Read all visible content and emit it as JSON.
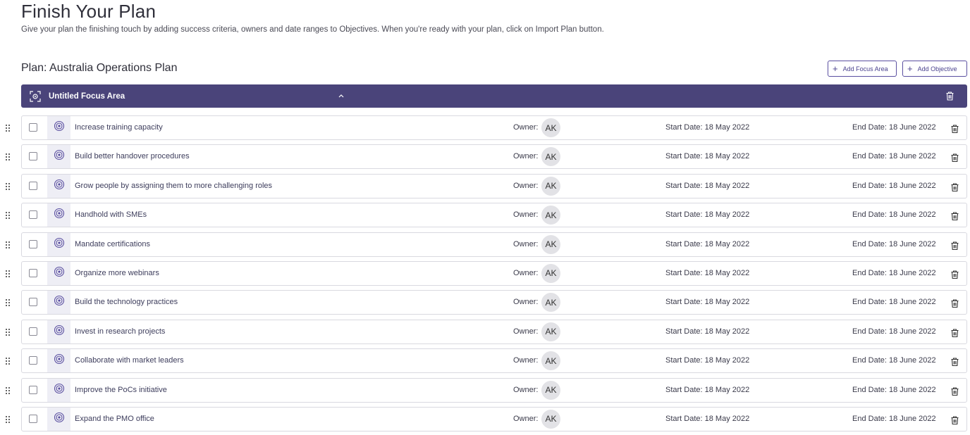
{
  "header": {
    "title": "Finish Your Plan",
    "subtitle": "Give your plan the finishing touch by adding success criteria, owners and date ranges to Objectives. When you're ready with your plan, click on Import Plan button."
  },
  "plan": {
    "title": "Plan: Australia Operations Plan",
    "add_focus_area_label": "Add Focus Area",
    "add_objective_label": "Add Objective"
  },
  "focus_area": {
    "title": "Untitled Focus Area"
  },
  "labels": {
    "owner": "Owner:"
  },
  "colors": {
    "focus_bar": "#4a447a",
    "accent": "#5a4fa0",
    "icon_bg": "#eeeef5"
  },
  "objectives": [
    {
      "title": "Increase training capacity",
      "owner": "AK",
      "start": "Start Date: 18 May 2022",
      "end": "End Date: 18 June 2022"
    },
    {
      "title": "Build better handover procedures",
      "owner": "AK",
      "start": "Start Date: 18 May 2022",
      "end": "End Date: 18 June 2022"
    },
    {
      "title": "Grow people by assigning them to more challenging roles",
      "owner": "AK",
      "start": "Start Date: 18 May 2022",
      "end": "End Date: 18 June 2022"
    },
    {
      "title": "Handhold with SMEs",
      "owner": "AK",
      "start": "Start Date: 18 May 2022",
      "end": "End Date: 18 June 2022"
    },
    {
      "title": "Mandate certifications",
      "owner": "AK",
      "start": "Start Date: 18 May 2022",
      "end": "End Date: 18 June 2022"
    },
    {
      "title": "Organize more webinars",
      "owner": "AK",
      "start": "Start Date: 18 May 2022",
      "end": "End Date: 18 June 2022"
    },
    {
      "title": "Build the technology practices",
      "owner": "AK",
      "start": "Start Date: 18 May 2022",
      "end": "End Date: 18 June 2022"
    },
    {
      "title": "Invest in research projects",
      "owner": "AK",
      "start": "Start Date: 18 May 2022",
      "end": "End Date: 18 June 2022"
    },
    {
      "title": "Collaborate with market leaders",
      "owner": "AK",
      "start": "Start Date: 18 May 2022",
      "end": "End Date: 18 June 2022"
    },
    {
      "title": "Improve the PoCs initiative",
      "owner": "AK",
      "start": "Start Date: 18 May 2022",
      "end": "End Date: 18 June 2022"
    },
    {
      "title": "Expand the PMO office",
      "owner": "AK",
      "start": "Start Date: 18 May 2022",
      "end": "End Date: 18 June 2022"
    }
  ]
}
